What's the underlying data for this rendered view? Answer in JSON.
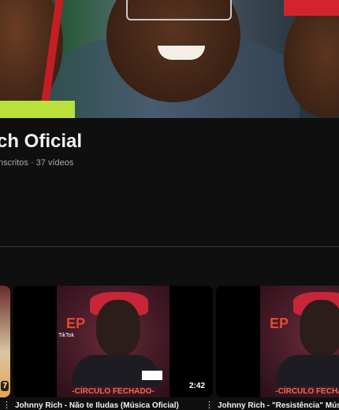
{
  "channel": {
    "name": "ch Oficial",
    "meta": "nscritos · 37 vídeos"
  },
  "videos": [
    {
      "duration": "7",
      "title": ""
    },
    {
      "duration": "2:42",
      "title": "Johnny Rich - Não te Iludas (Música Oficial)",
      "cover_text": "-CÍRCULO FECHADO-",
      "ep": "EP",
      "tiktok": "TikTok"
    },
    {
      "duration": "",
      "title": "Johnny Rich - \"Resistência\" Música",
      "cover_text": "-CÍRCULO FECHADO-",
      "ep": "EP"
    }
  ],
  "icons": {
    "more": "⋮"
  }
}
